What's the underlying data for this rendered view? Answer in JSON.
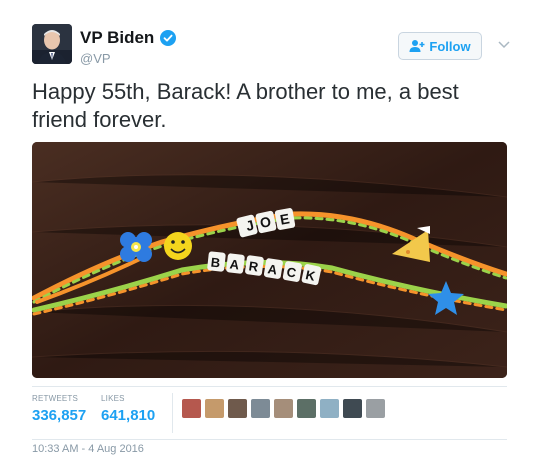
{
  "author": {
    "name": "VP Biden",
    "handle": "@VP",
    "verified": true
  },
  "follow": {
    "label": "Follow",
    "icon": "add-user-icon"
  },
  "tweet": {
    "text": "Happy 55th, Barack! A brother to me, a best friend forever."
  },
  "media": {
    "bracelet_words": [
      "JOE",
      "BARACK"
    ],
    "icons": [
      "flower-bead-icon",
      "smiley-bead-icon",
      "star-bead-icon",
      "cake-bead-icon"
    ]
  },
  "stats": {
    "retweets_label": "RETWEETS",
    "retweets_value": "336,857",
    "likes_label": "LIKES",
    "likes_value": "641,810"
  },
  "timestamp": "10:33 AM - 4 Aug 2016",
  "colors": {
    "accent": "#1da1f2",
    "name": "#14171a",
    "muted": "#8899a6"
  }
}
